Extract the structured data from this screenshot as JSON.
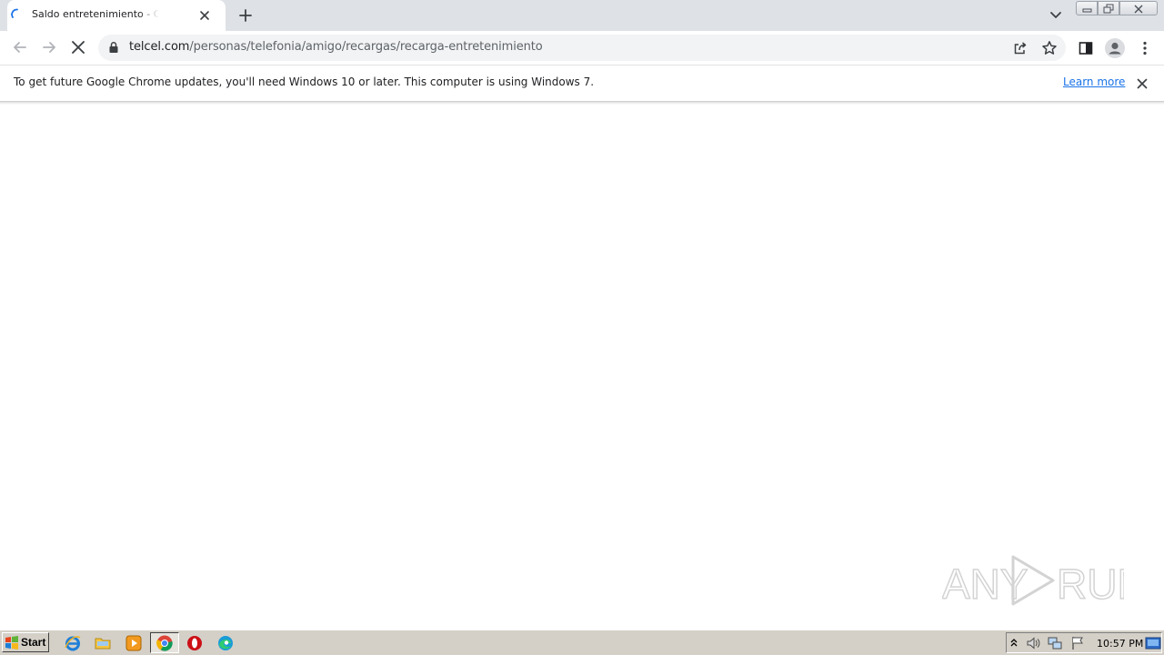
{
  "browser": {
    "tab": {
      "title": "Saldo entretenimiento - Compra el m",
      "state": "loading"
    },
    "toolbar": {
      "url_domain": "telcel.com",
      "url_path": "/personas/telefonia/amigo/recargas/recarga-entretenimiento"
    },
    "infobar": {
      "message": "To get future Google Chrome updates, you'll need Windows 10 or later. This computer is using Windows 7.",
      "link": "Learn more"
    }
  },
  "watermark": {
    "text_left": "ANY",
    "text_right": "RUN"
  },
  "taskbar": {
    "start_label": "Start",
    "apps": [
      "internet-explorer-icon",
      "folder-icon",
      "media-player-icon",
      "chrome-icon",
      "opera-icon",
      "edge-icon"
    ],
    "clock": "10:57 PM"
  },
  "colors": {
    "accent": "#1a73e8",
    "tabstrip": "#dee1e6",
    "taskbar": "#d4d0c8"
  }
}
